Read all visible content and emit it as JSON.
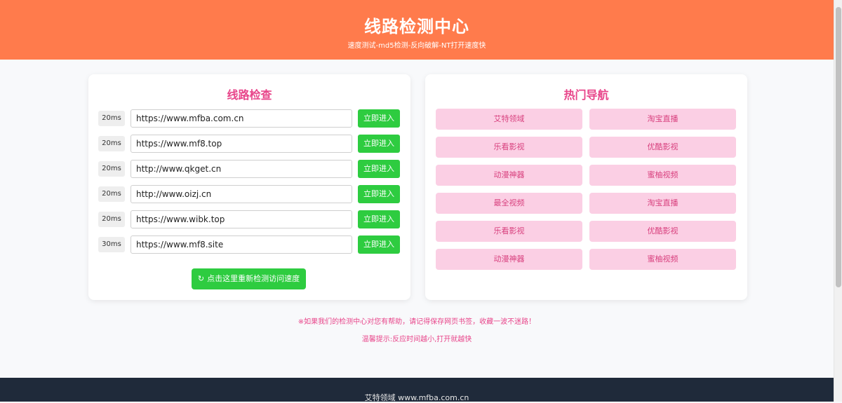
{
  "header": {
    "title": "线路检测中心",
    "subtitle": "速度测试-md5检测-反向破解-NT打开速度快"
  },
  "check_panel": {
    "title": "线路检查",
    "rows": [
      {
        "latency": "20ms",
        "url": "https://www.mfba.com.cn",
        "button": "立即进入"
      },
      {
        "latency": "20ms",
        "url": "https://www.mf8.top",
        "button": "立即进入"
      },
      {
        "latency": "20ms",
        "url": "http://www.qkget.cn",
        "button": "立即进入"
      },
      {
        "latency": "20ms",
        "url": "http://www.oizj.cn",
        "button": "立即进入"
      },
      {
        "latency": "20ms",
        "url": "https://www.wibk.top",
        "button": "立即进入"
      },
      {
        "latency": "30ms",
        "url": "https://www.mf8.site",
        "button": "立即进入"
      }
    ],
    "recheck_label": "点击这里重新检测访问速度",
    "recheck_icon": "refresh-icon"
  },
  "nav_panel": {
    "title": "热门导航",
    "items": [
      "艾特领域",
      "淘宝直播",
      "乐看影视",
      "优酷影视",
      "动漫神器",
      "蜜柚视频",
      "最全视频",
      "淘宝直播",
      "乐看影视",
      "优酷影视",
      "动漫神器",
      "蜜柚视频"
    ]
  },
  "notices": {
    "bookmark": "※如果我们的检测中心对您有帮助，请记得保存网页书签，收藏一波不迷路！",
    "tip": "温馨提示:反应时间越小,打开就越快"
  },
  "footer": {
    "text": "艾特领域 www.mfba.com.cn"
  },
  "colors": {
    "header_bg": "#ff7b4c",
    "accent_pink": "#e8458a",
    "button_green": "#2ecc40",
    "nav_btn_bg": "#fbcfe4",
    "footer_bg": "#1f2a3a"
  }
}
